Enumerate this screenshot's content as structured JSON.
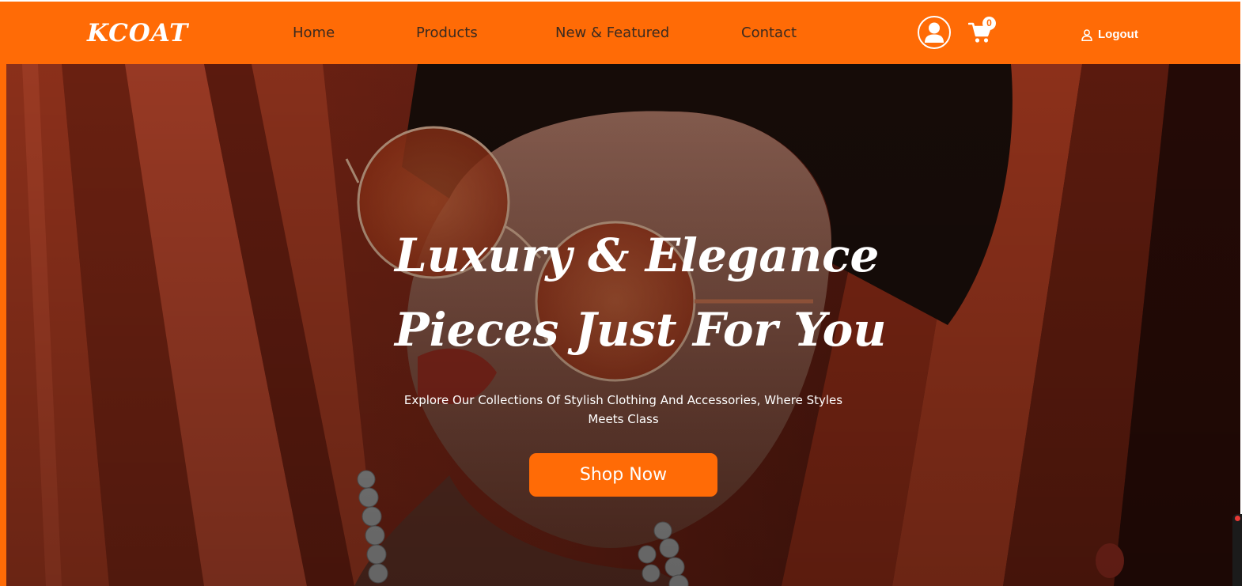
{
  "brand": {
    "logo": "KCOAT"
  },
  "nav": {
    "links": [
      "Home",
      "Products",
      "New & Featured",
      "Contact"
    ]
  },
  "header": {
    "cart_count": "0",
    "logout_label": "Logout",
    "avatar_icon": "user-circle-icon",
    "cart_icon": "shopping-cart-icon",
    "logout_icon": "user-outline-icon"
  },
  "hero": {
    "title_line_1": "Luxury & Elegance",
    "title_line_2": "Pieces Just For You",
    "subtitle": "Explore Our Collections Of Stylish Clothing And Accessories, Where Styles Meets Class",
    "cta_label": "Shop Now"
  },
  "colors": {
    "brand_orange": "#ff6b06",
    "text_dark": "#3a2a20",
    "white": "#ffffff"
  }
}
